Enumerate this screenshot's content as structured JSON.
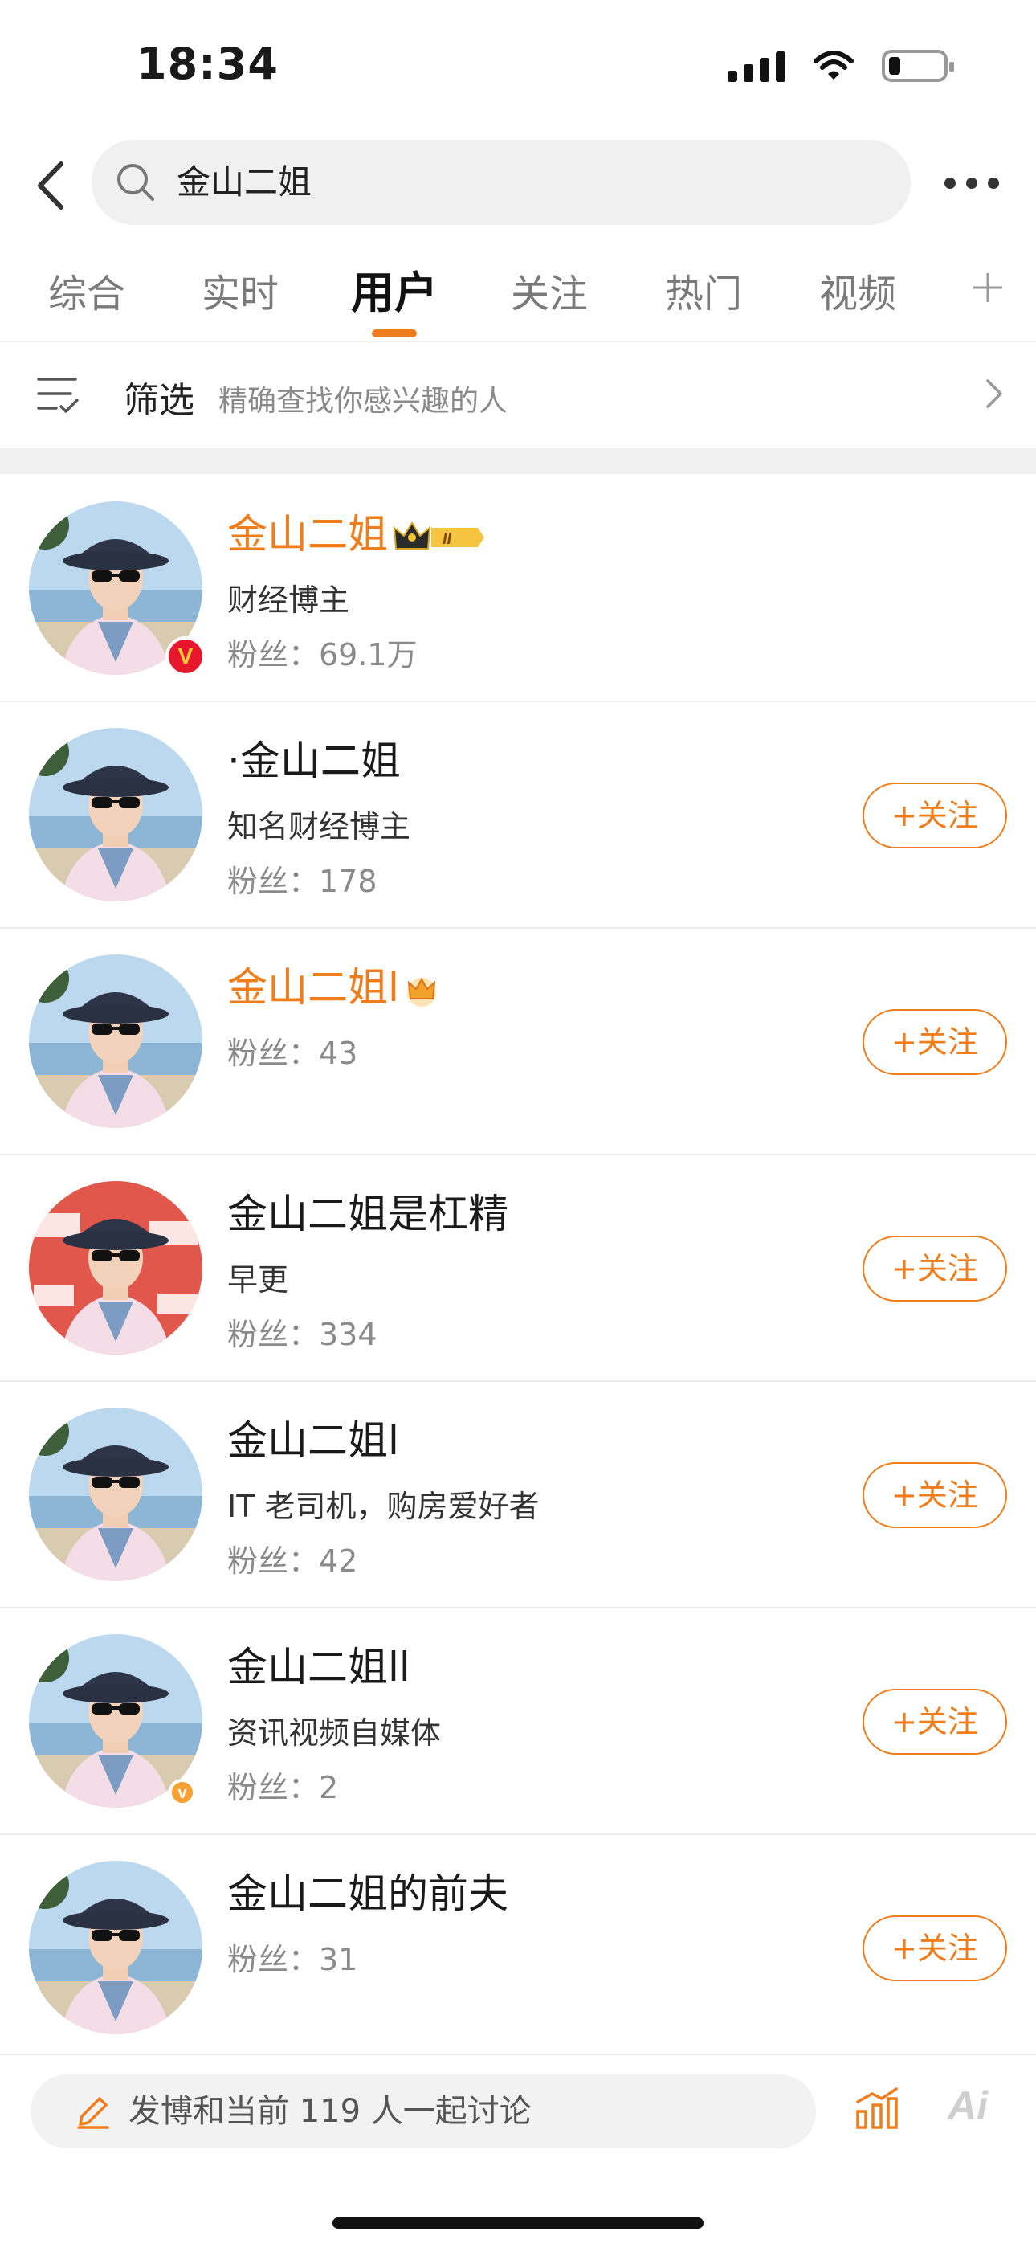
{
  "status_bar": {
    "time": "18:34"
  },
  "search": {
    "query": "金山二姐"
  },
  "tabs": [
    {
      "label": "综合"
    },
    {
      "label": "实时"
    },
    {
      "label": "用户"
    },
    {
      "label": "关注"
    },
    {
      "label": "热门"
    },
    {
      "label": "视频"
    }
  ],
  "active_tab": "用户",
  "filter": {
    "label": "筛选",
    "hint": "精确查找你感兴趣的人"
  },
  "users": [
    {
      "name": "金山二姐",
      "desc": "财经博主",
      "fans": "粉丝：69.1万",
      "highlight": true,
      "badge": "V",
      "level": "II",
      "followed": true
    },
    {
      "name": "·金山二姐",
      "desc": "知名财经博主",
      "fans": "粉丝：178",
      "follow_label": "+关注"
    },
    {
      "name": "金山二姐l",
      "fans": "粉丝：43",
      "highlight": true,
      "follow_label": "+关注"
    },
    {
      "name": "金山二姐是杠精",
      "desc": "早更",
      "fans": "粉丝：334",
      "follow_label": "+关注"
    },
    {
      "name": "金山二姐l",
      "desc": "IT 老司机，购房爱好者",
      "fans": "粉丝：42",
      "follow_label": "+关注"
    },
    {
      "name": "金山二姐ll",
      "desc": "资讯视频自媒体",
      "fans": "粉丝：2",
      "follow_label": "+关注"
    },
    {
      "name": "金山二姐的前夫",
      "fans": "粉丝：31",
      "follow_label": "+关注"
    }
  ],
  "bottom_bar": {
    "discuss_text": "发博和当前 119 人一起讨论",
    "ai_label": "Ai"
  },
  "colors": {
    "accent": "#f07d1c",
    "verified": "#e6162d"
  }
}
